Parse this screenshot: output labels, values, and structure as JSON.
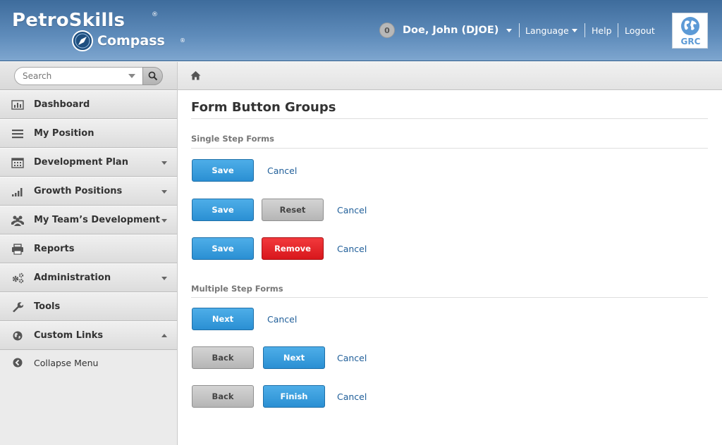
{
  "header": {
    "brand": "PetroSkills",
    "brand_mark": "®",
    "product": "Compass",
    "product_mark": "®",
    "notifications_count": "0",
    "user_name": "Doe, John (DJOE)",
    "language_label": "Language",
    "help_label": "Help",
    "logout_label": "Logout",
    "org_badge": "GRC"
  },
  "search": {
    "placeholder": "Search"
  },
  "sidebar": {
    "items": [
      {
        "label": "Dashboard",
        "icon": "bar-chart-icon",
        "has_caret": false
      },
      {
        "label": "My Position",
        "icon": "list-icon",
        "has_caret": false
      },
      {
        "label": "Development Plan",
        "icon": "calendar-icon",
        "has_caret": true
      },
      {
        "label": "Growth Positions",
        "icon": "signal-icon",
        "has_caret": true
      },
      {
        "label": "My Team’s Development",
        "icon": "team-icon",
        "has_caret": true
      },
      {
        "label": "Reports",
        "icon": "printer-icon",
        "has_caret": false
      },
      {
        "label": "Administration",
        "icon": "gears-icon",
        "has_caret": true
      },
      {
        "label": "Tools",
        "icon": "wrench-icon",
        "has_caret": false
      },
      {
        "label": "Custom Links",
        "icon": "globe-icon",
        "has_caret": true
      }
    ],
    "collapse_label": "Collapse Menu"
  },
  "breadcrumb": {
    "home_icon": "home-icon"
  },
  "main": {
    "title": "Form Button Groups",
    "single_step": {
      "heading": "Single Step Forms",
      "rows": [
        {
          "buttons": [
            "Save"
          ],
          "cancel": "Cancel"
        },
        {
          "buttons": [
            "Save",
            "Reset"
          ],
          "cancel": "Cancel"
        },
        {
          "buttons": [
            "Save",
            "Remove"
          ],
          "cancel": "Cancel"
        }
      ]
    },
    "multi_step": {
      "heading": "Multiple Step Forms",
      "rows": [
        {
          "buttons": [
            "Next"
          ],
          "cancel": "Cancel"
        },
        {
          "buttons": [
            "Back",
            "Next"
          ],
          "cancel": "Cancel"
        },
        {
          "buttons": [
            "Back",
            "Finish"
          ],
          "cancel": "Cancel"
        }
      ]
    }
  },
  "colors": {
    "header_blue": "#4f7eae",
    "primary_button": "#2a8fd3",
    "danger_button": "#d8171c",
    "secondary_button": "#b5b5b5",
    "link": "#1f5e99"
  }
}
